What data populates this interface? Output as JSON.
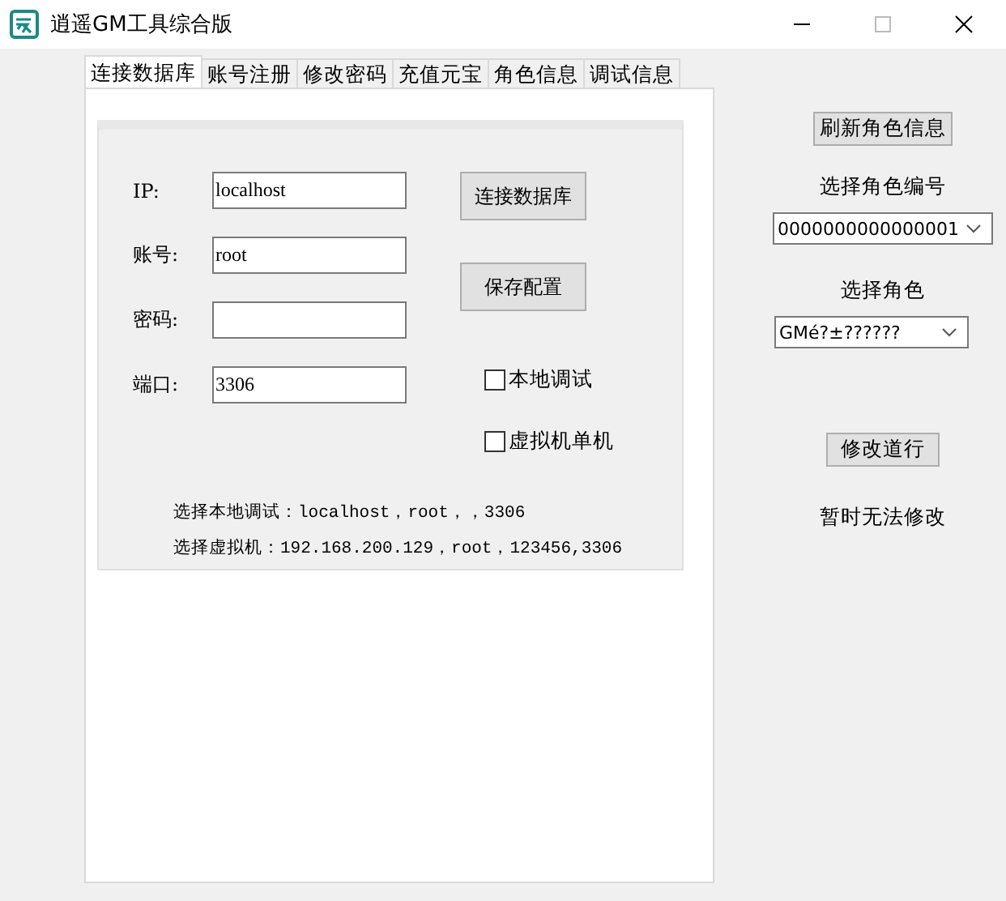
{
  "window": {
    "title": "逍遥GM工具综合版"
  },
  "tabs": [
    {
      "label": "连接数据库",
      "selected": true
    },
    {
      "label": "账号注册",
      "selected": false
    },
    {
      "label": "修改密码",
      "selected": false
    },
    {
      "label": "充值元宝",
      "selected": false
    },
    {
      "label": "角色信息",
      "selected": false
    },
    {
      "label": "调试信息",
      "selected": false
    }
  ],
  "connection": {
    "fields": [
      {
        "label": "IP:",
        "value": "localhost"
      },
      {
        "label": "账号:",
        "value": "root"
      },
      {
        "label": "密码:"
      },
      {
        "label": "端口:",
        "value": "3306"
      }
    ],
    "buttons": [
      "连接数据库",
      "保存配置"
    ],
    "checkboxes": [
      {
        "label": "本地调试",
        "checked": false
      },
      {
        "label": "虚拟机单机",
        "checked": false
      }
    ],
    "notes": [
      "选择本地调试：localhost，root，，3306",
      "选择虚拟机：192.168.200.129，root，123456,3306"
    ]
  },
  "role_panel": {
    "refresh_button": "刷新角色信息",
    "id_label": "选择角色编号",
    "id_select": {
      "value": "0000000000000001"
    },
    "role_label": "选择角色",
    "role_select": {
      "value": "GMé?±??????"
    },
    "modify_button": "修改道行",
    "status": "暂时无法修改"
  }
}
